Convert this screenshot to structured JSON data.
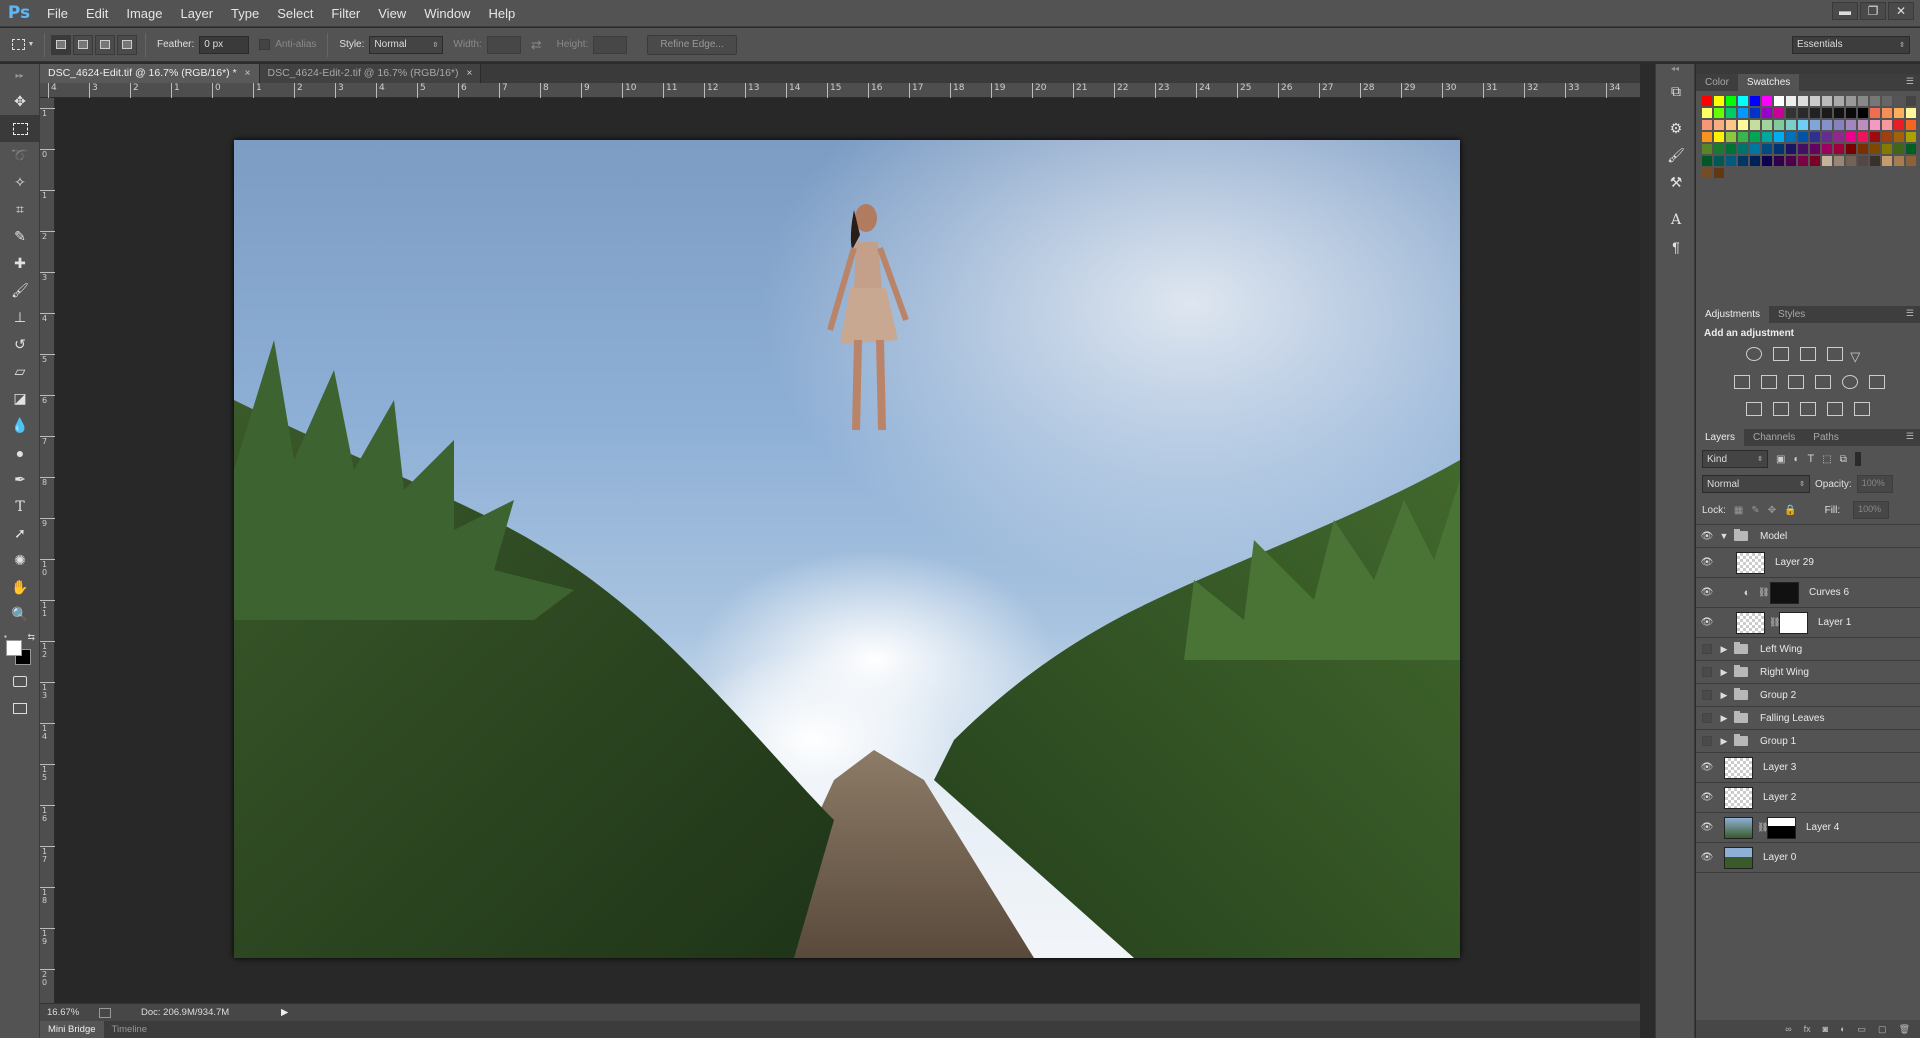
{
  "app": {
    "logo": "Ps"
  },
  "menu": [
    "File",
    "Edit",
    "Image",
    "Layer",
    "Type",
    "Select",
    "Filter",
    "View",
    "Window",
    "Help"
  ],
  "window_buttons": {
    "minimize": "▬",
    "restore": "❐",
    "close": "✕"
  },
  "options": {
    "feather_label": "Feather:",
    "feather_value": "0 px",
    "antialias_label": "Anti-alias",
    "style_label": "Style:",
    "style_value": "Normal",
    "width_label": "Width:",
    "height_label": "Height:",
    "refine_edge": "Refine Edge...",
    "workspace": "Essentials"
  },
  "tabs": [
    {
      "label": "DSC_4624-Edit.tif @ 16.7% (RGB/16*) *",
      "close": "×"
    },
    {
      "label": "DSC_4624-Edit-2.tif @ 16.7% (RGB/16*)",
      "close": "×"
    }
  ],
  "ruler_h": [
    "4",
    "3",
    "2",
    "1",
    "0",
    "1",
    "2",
    "3",
    "4",
    "5",
    "6",
    "7",
    "8",
    "9",
    "10",
    "11",
    "12",
    "13",
    "14",
    "15",
    "16",
    "17",
    "18",
    "19",
    "20",
    "21",
    "22",
    "23",
    "24",
    "25",
    "26",
    "27",
    "28",
    "29",
    "30",
    "31",
    "32",
    "33",
    "34"
  ],
  "ruler_v": [
    "1",
    "0",
    "1",
    "2",
    "3",
    "4",
    "5",
    "6",
    "7",
    "8",
    "9",
    "1 0",
    "1 1",
    "1 2",
    "1 3",
    "1 4",
    "1 5",
    "1 6",
    "1 7",
    "1 8",
    "1 9",
    "2 0"
  ],
  "status": {
    "zoom": "16.67%",
    "doc": "Doc: 206.9M/934.7M"
  },
  "bottom_tabs": [
    "Mini Bridge",
    "Timeline"
  ],
  "color_panel": {
    "tabs": [
      "Color",
      "Swatches"
    ]
  },
  "swatch_rows": [
    [
      "#ff0000",
      "#ffff00",
      "#00ff00",
      "#00ffff",
      "#0000ff",
      "#ff00ff",
      "#ffffff",
      "#eeeeee",
      "#dddddd",
      "#cccccc",
      "#bbbbbb",
      "#aaaaaa",
      "#999999",
      "#888888",
      "#777777",
      "#666666",
      "#555555",
      "#444444"
    ],
    [
      "#ffff66",
      "#66ff00",
      "#00cc66",
      "#0099ff",
      "#0033cc",
      "#9900cc",
      "#cc0099",
      "#333333",
      "#2a2a2a",
      "#222222",
      "#1a1a1a",
      "#111111",
      "#0a0a0a",
      "#000000",
      "#f26c4f",
      "#f68e56",
      "#fbaf5d",
      "#fff799"
    ],
    [
      "#f7977a",
      "#f9ad81",
      "#fdc68a",
      "#fff79a",
      "#c4df9b",
      "#a3d39c",
      "#82ca9d",
      "#7bcdc8",
      "#6ecff6",
      "#7ea7d8",
      "#8393ca",
      "#8781bd",
      "#a187be",
      "#bc8dbf",
      "#f49ac2",
      "#f6989d",
      "#ed1c24",
      "#f26522"
    ],
    [
      "#f7941d",
      "#fff200",
      "#8dc63f",
      "#39b54a",
      "#00a651",
      "#00a99d",
      "#00aeef",
      "#0072bc",
      "#0054a6",
      "#2e3192",
      "#662d91",
      "#92278f",
      "#ec008c",
      "#ed145b",
      "#9e0b0f",
      "#a0410d",
      "#a36209",
      "#aba000"
    ],
    [
      "#598527",
      "#197b30",
      "#007236",
      "#00746b",
      "#0076a3",
      "#004b80",
      "#003471",
      "#1b1464",
      "#440e62",
      "#630460",
      "#9e005d",
      "#9e0039",
      "#790000",
      "#7b2e00",
      "#7d4900",
      "#827b00",
      "#406618",
      "#005e20"
    ],
    [
      "#005826",
      "#005952",
      "#005b7f",
      "#003663",
      "#002157",
      "#0d004c",
      "#32004b",
      "#4b0049",
      "#7b0046",
      "#7a0026",
      "#c7b299",
      "#998675",
      "#736357",
      "#534741",
      "#37302d",
      "#c69c6d",
      "#a67c52",
      "#8c6239"
    ],
    [
      "#754c24",
      "#603913"
    ]
  ],
  "adjustments": {
    "tabs": [
      "Adjustments",
      "Styles"
    ],
    "heading": "Add an adjustment"
  },
  "layers_panel": {
    "tabs": [
      "Layers",
      "Channels",
      "Paths"
    ],
    "kind": "Kind",
    "blend": "Normal",
    "opacity_label": "Opacity:",
    "opacity_value": "100%",
    "lock_label": "Lock:",
    "fill_label": "Fill:",
    "fill_value": "100%"
  },
  "layers": [
    {
      "name": "Model",
      "type": "group",
      "open": true,
      "visible": true
    },
    {
      "name": "Layer 29",
      "type": "layer",
      "visible": true
    },
    {
      "name": "Curves 6",
      "type": "adjustment",
      "visible": true
    },
    {
      "name": "Layer 1",
      "type": "masked",
      "visible": true
    },
    {
      "name": "Left Wing",
      "type": "group",
      "visible": false
    },
    {
      "name": "Right Wing",
      "type": "group",
      "visible": false
    },
    {
      "name": "Group 2",
      "type": "group",
      "visible": false
    },
    {
      "name": "Falling Leaves",
      "type": "group",
      "visible": false
    },
    {
      "name": "Group 1",
      "type": "group",
      "visible": false
    },
    {
      "name": "Layer 3",
      "type": "layer",
      "visible": true
    },
    {
      "name": "Layer 2",
      "type": "layer",
      "visible": true
    },
    {
      "name": "Layer 4",
      "type": "photo-masked",
      "visible": true
    },
    {
      "name": "Layer 0",
      "type": "photo",
      "visible": true
    }
  ]
}
